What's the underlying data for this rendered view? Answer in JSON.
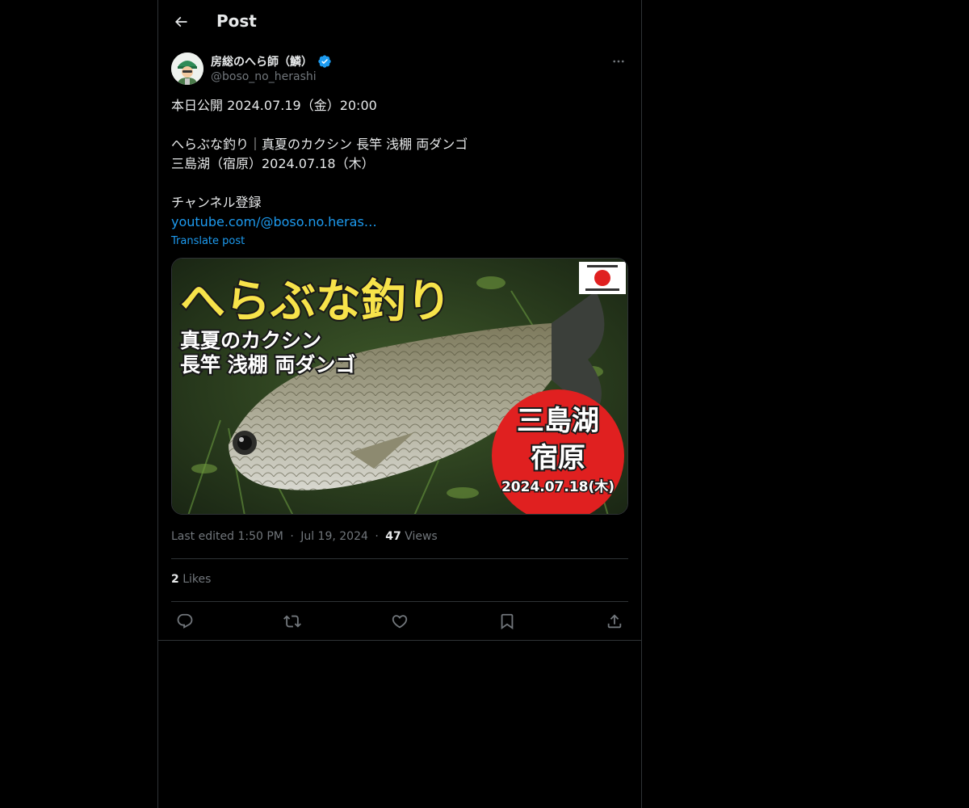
{
  "header": {
    "title": "Post"
  },
  "author": {
    "display_name": "房総のへら師（鱗）",
    "handle": "@boso_no_herashi",
    "verified": true
  },
  "tweet": {
    "lines": [
      "本日公開 2024.07.19（金）20:00",
      "",
      "へらぶな釣り｜真夏のカクシン 長竿 浅棚 両ダンゴ",
      "三島湖（宿原）2024.07.18（木）",
      "",
      "チャンネル登録"
    ],
    "link": "youtube.com/@boso.no.heras…",
    "translate": "Translate post"
  },
  "media": {
    "title": "へらぶな釣り",
    "subtitle_1": "真夏のカクシン",
    "subtitle_2": "長竿  浅棚  両ダンゴ",
    "place_1": "三島湖",
    "place_2": "宿原",
    "date": "2024.07.18(木)"
  },
  "meta": {
    "edited": "Last edited 1:50 PM",
    "sep1": "·",
    "date": "Jul 19, 2024",
    "sep2": "·",
    "views_count": "47",
    "views_label": "Views"
  },
  "likes": {
    "count": "2",
    "label": "Likes"
  },
  "colors": {
    "accent": "#1d9bf0",
    "background": "#000000",
    "border": "#2f3336",
    "muted": "#71767b"
  },
  "icons": {
    "back": "arrow-left-icon",
    "more": "more-icon",
    "verified": "verified-badge-icon",
    "reply": "reply-icon",
    "repost": "repost-icon",
    "like": "heart-icon",
    "bookmark": "bookmark-icon",
    "share": "share-icon"
  }
}
